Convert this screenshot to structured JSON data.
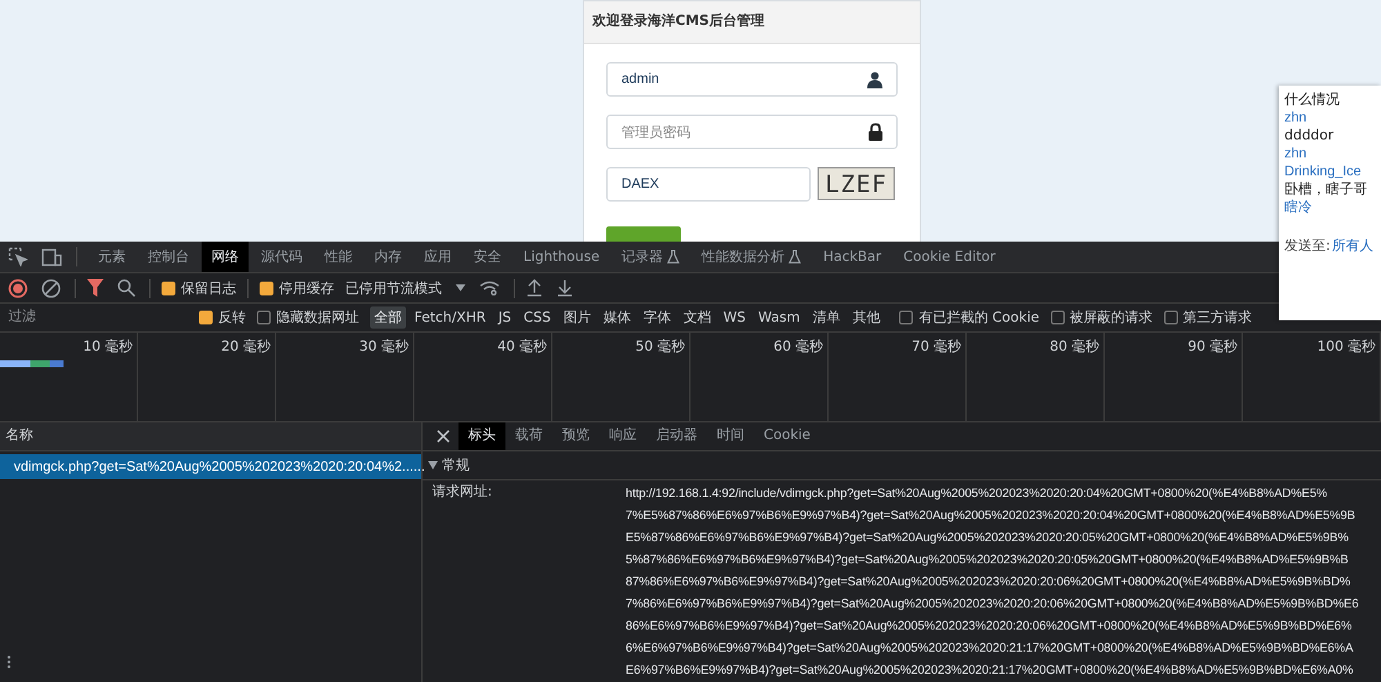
{
  "login": {
    "title": "欢迎登录海洋CMS后台管理",
    "username": {
      "value": "admin"
    },
    "password": {
      "placeholder": "管理员密码"
    },
    "captcha": {
      "value": "DAEX",
      "image_text": "LZEF"
    }
  },
  "chat": {
    "messages": [
      {
        "kind": "text",
        "text": "什么情况"
      },
      {
        "kind": "user",
        "text": "zhn"
      },
      {
        "kind": "text",
        "text": "ddddor"
      },
      {
        "kind": "user",
        "text": "zhn"
      },
      {
        "kind": "user",
        "text": "Drinking_Ice"
      },
      {
        "kind": "text",
        "text": "卧槽，瞎子哥"
      },
      {
        "kind": "user",
        "text": "瞎冷"
      }
    ],
    "send_to": "发送至:",
    "recipient": "所有人"
  },
  "devtools": {
    "panel_tabs": [
      {
        "label": "元素",
        "selected": false,
        "flask": false
      },
      {
        "label": "控制台",
        "selected": false,
        "flask": false
      },
      {
        "label": "网络",
        "selected": true,
        "flask": false
      },
      {
        "label": "源代码",
        "selected": false,
        "flask": false
      },
      {
        "label": "性能",
        "selected": false,
        "flask": false
      },
      {
        "label": "内存",
        "selected": false,
        "flask": false
      },
      {
        "label": "应用",
        "selected": false,
        "flask": false
      },
      {
        "label": "安全",
        "selected": false,
        "flask": false
      },
      {
        "label": "Lighthouse",
        "selected": false,
        "flask": false
      },
      {
        "label": "记录器",
        "selected": false,
        "flask": true
      },
      {
        "label": "性能数据分析",
        "selected": false,
        "flask": true
      },
      {
        "label": "HackBar",
        "selected": false,
        "flask": false
      },
      {
        "label": "Cookie Editor",
        "selected": false,
        "flask": false
      }
    ],
    "toolbar": {
      "preserve_log": {
        "label": "保留日志",
        "checked": true
      },
      "disable_cache": {
        "label": "停用缓存",
        "checked": true
      },
      "throttling": "已停用节流模式"
    },
    "filter": {
      "placeholder": "过滤",
      "invert": {
        "label": "反转",
        "checked": true
      },
      "hide_data_urls": {
        "label": "隐藏数据网址",
        "checked": false
      },
      "types": [
        {
          "label": "全部",
          "selected": true
        },
        {
          "label": "Fetch/XHR",
          "selected": false
        },
        {
          "label": "JS",
          "selected": false
        },
        {
          "label": "CSS",
          "selected": false
        },
        {
          "label": "图片",
          "selected": false
        },
        {
          "label": "媒体",
          "selected": false
        },
        {
          "label": "字体",
          "selected": false
        },
        {
          "label": "文档",
          "selected": false
        },
        {
          "label": "WS",
          "selected": false
        },
        {
          "label": "Wasm",
          "selected": false
        },
        {
          "label": "清单",
          "selected": false
        },
        {
          "label": "其他",
          "selected": false
        }
      ],
      "blocked_cookies": {
        "label": "有已拦截的 Cookie",
        "checked": false
      },
      "blocked_requests": {
        "label": "被屏蔽的请求",
        "checked": false
      },
      "third_party": {
        "label": "第三方请求",
        "checked": false
      }
    },
    "timeline": {
      "ticks": [
        "10 毫秒",
        "20 毫秒",
        "30 毫秒",
        "40 毫秒",
        "50 毫秒",
        "60 毫秒",
        "70 毫秒",
        "80 毫秒",
        "90 毫秒",
        "100 毫秒"
      ]
    },
    "requests": {
      "header": "名称",
      "rows": [
        {
          "name": "vdimgck.php?get=Sat%20Aug%2005%202023%2020:20:04%2......",
          "selected": true
        }
      ]
    },
    "detail": {
      "tabs": [
        {
          "label": "标头",
          "selected": true
        },
        {
          "label": "载荷",
          "selected": false
        },
        {
          "label": "预览",
          "selected": false
        },
        {
          "label": "响应",
          "selected": false
        },
        {
          "label": "启动器",
          "selected": false
        },
        {
          "label": "时间",
          "selected": false
        },
        {
          "label": "Cookie",
          "selected": false
        }
      ],
      "section": {
        "title": "常规",
        "expanded": true
      },
      "fields": [
        {
          "label": "请求网址:",
          "lines": [
            "http://192.168.1.4:92/include/vdimgck.php?get=Sat%20Aug%2005%202023%2020:20:04%20GMT+0800%20(%E4%B8%AD%E5%",
            "7%E5%87%86%E6%97%B6%E9%97%B4)?get=Sat%20Aug%2005%202023%2020:20:04%20GMT+0800%20(%E4%B8%AD%E5%9B",
            "E5%87%86%E6%97%B6%E9%97%B4)?get=Sat%20Aug%2005%202023%2020:20:05%20GMT+0800%20(%E4%B8%AD%E5%9B%",
            "5%87%86%E6%97%B6%E9%97%B4)?get=Sat%20Aug%2005%202023%2020:20:05%20GMT+0800%20(%E4%B8%AD%E5%9B%B",
            "87%86%E6%97%B6%E9%97%B4)?get=Sat%20Aug%2005%202023%2020:20:06%20GMT+0800%20(%E4%B8%AD%E5%9B%BD%",
            "7%86%E6%97%B6%E9%97%B4)?get=Sat%20Aug%2005%202023%2020:20:06%20GMT+0800%20(%E4%B8%AD%E5%9B%BD%E6",
            "86%E6%97%B6%E9%97%B4)?get=Sat%20Aug%2005%202023%2020:20:06%20GMT+0800%20(%E4%B8%AD%E5%9B%BD%E6%",
            "6%E6%97%B6%E9%97%B4)?get=Sat%20Aug%2005%202023%2020:21:17%20GMT+0800%20(%E4%B8%AD%E5%9B%BD%E6%A",
            "E6%97%B6%E9%97%B4)?get=Sat%20Aug%2005%202023%2020:21:17%20GMT+0800%20(%E4%B8%AD%E5%9B%BD%E6%A0%"
          ]
        }
      ]
    }
  }
}
